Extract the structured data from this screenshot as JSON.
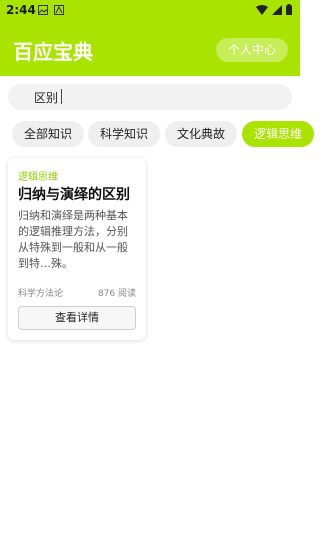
{
  "status": {
    "time": "2:44"
  },
  "header": {
    "title": "百应宝典",
    "profile_button": "个人中心"
  },
  "search": {
    "value": "区别"
  },
  "categories": [
    {
      "label": "全部知识",
      "active": false
    },
    {
      "label": "科学知识",
      "active": false
    },
    {
      "label": "文化典故",
      "active": false
    },
    {
      "label": "逻辑思维",
      "active": true
    }
  ],
  "results": [
    {
      "category": "逻辑思维",
      "title": "归纳与演绎的区别",
      "description": "归纳和演绎是两种基本的逻辑推理方法，分别从特殊到一般和从一般到特…殊。",
      "tag": "科学方法论",
      "reads": "876 阅读",
      "button": "查看详情"
    }
  ],
  "colors": {
    "accent": "#a9e300"
  }
}
